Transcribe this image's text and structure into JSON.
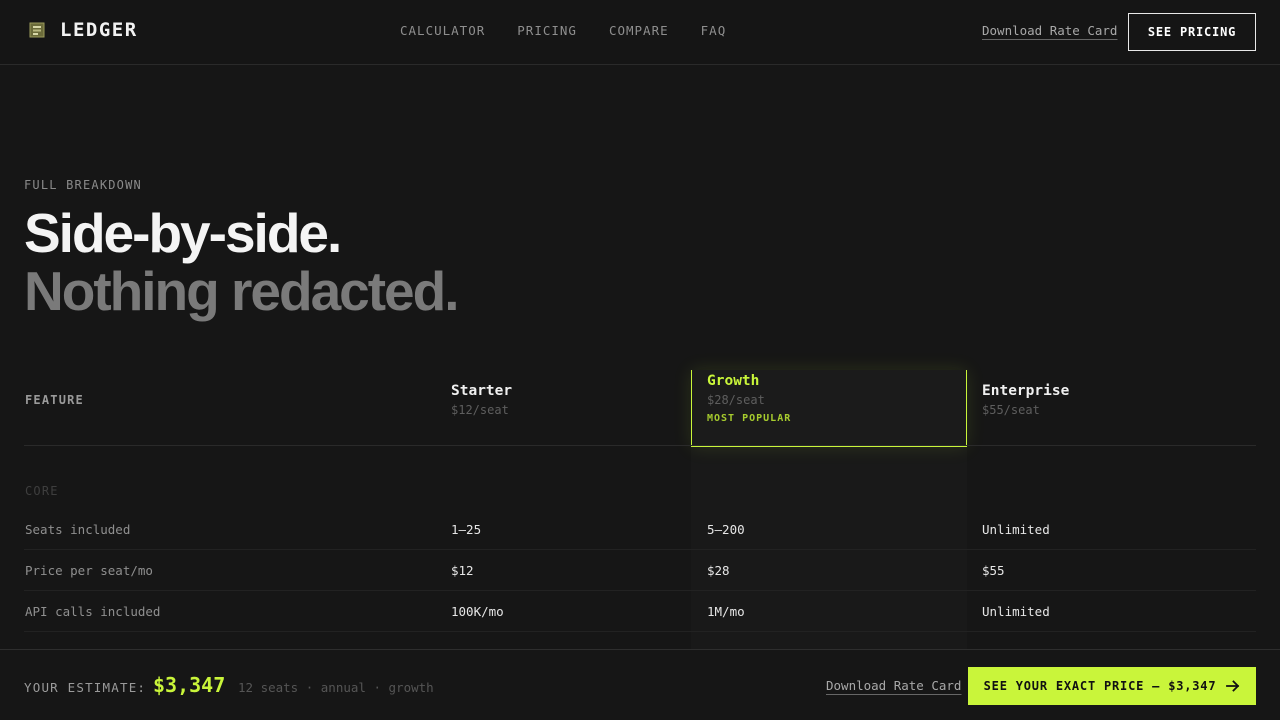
{
  "brand": {
    "name": "LEDGER",
    "icon": "ledger-logo-icon"
  },
  "nav": {
    "items": [
      "CALCULATOR",
      "PRICING",
      "COMPARE",
      "FAQ"
    ],
    "download_link": "Download Rate Card",
    "cta": "SEE PRICING"
  },
  "hero": {
    "eyebrow": "FULL BREAKDOWN",
    "line1": "Side-by-side.",
    "line2": "Nothing redacted."
  },
  "table": {
    "feature_header": "FEATURE",
    "plans": [
      {
        "name": "Starter",
        "price": "$12/seat"
      },
      {
        "name": "Growth",
        "price": "$28/seat",
        "badge": "MOST POPULAR"
      },
      {
        "name": "Enterprise",
        "price": "$55/seat"
      }
    ],
    "section": "CORE",
    "rows": [
      {
        "feature": "Seats included",
        "starter": "1–25",
        "growth": "5–200",
        "enterprise": "Unlimited"
      },
      {
        "feature": "Price per seat/mo",
        "starter": "$12",
        "growth": "$28",
        "enterprise": "$55"
      },
      {
        "feature": "API calls included",
        "starter": "100K/mo",
        "growth": "1M/mo",
        "enterprise": "Unlimited"
      }
    ]
  },
  "estimate": {
    "label": "YOUR ESTIMATE:",
    "value": "$3,347",
    "meta": "12 seats · annual · growth",
    "download_link": "Download Rate Card",
    "cta": "SEE YOUR EXACT PRICE — $3,347"
  },
  "colors": {
    "accent": "#c9f53a",
    "background": "#161616"
  }
}
